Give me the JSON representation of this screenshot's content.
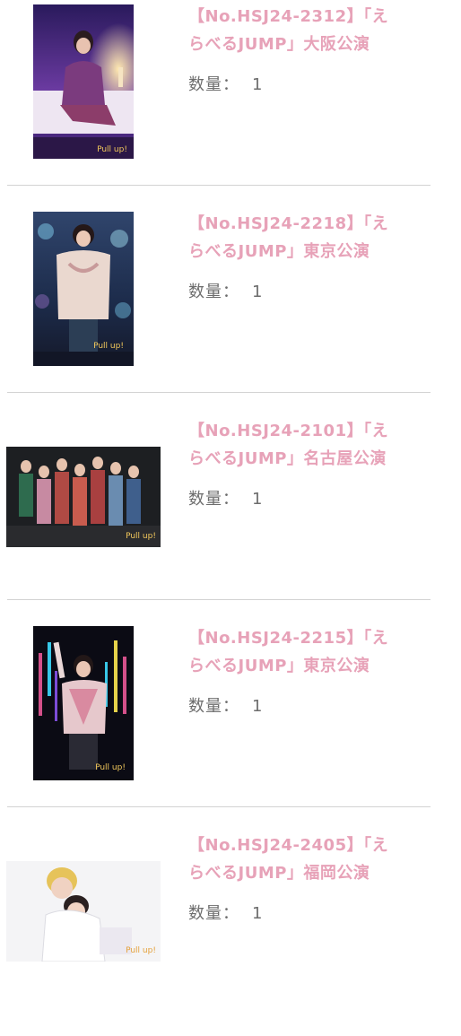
{
  "items": [
    {
      "title_line1": "【No.HSJ24-2312】「え",
      "title_line2": "らべるJUMP」大阪公演",
      "quantity_label": "数量：",
      "quantity_value": "1",
      "photo": {
        "orientation": "portrait",
        "scene": "solo-seated-candle",
        "colors": [
          "#3a1f6e",
          "#b05ab8",
          "#f2e7f5"
        ]
      }
    },
    {
      "title_line1": "【No.HSJ24-2218】「え",
      "title_line2": "らべるJUMP」東京公演",
      "quantity_label": "数量：",
      "quantity_value": "1",
      "photo": {
        "orientation": "portrait",
        "scene": "solo-heart-hands",
        "colors": [
          "#1c2b4a",
          "#e9d2cf",
          "#6aa7c8"
        ]
      }
    },
    {
      "title_line1": "【No.HSJ24-2101】「え",
      "title_line2": "らべるJUMP」名古屋公演",
      "quantity_label": "数量：",
      "quantity_value": "1",
      "photo": {
        "orientation": "landscape",
        "scene": "group-stage",
        "colors": [
          "#1d1f22",
          "#b04a44",
          "#2e6b4e"
        ]
      }
    },
    {
      "title_line1": "【No.HSJ24-2215】「え",
      "title_line2": "らべるJUMP」東京公演",
      "quantity_label": "数量：",
      "quantity_value": "1",
      "photo": {
        "orientation": "portrait",
        "scene": "solo-neon-lights",
        "colors": [
          "#0b0b14",
          "#d4508a",
          "#38c8e8"
        ]
      }
    },
    {
      "title_line1": "【No.HSJ24-2405】「え",
      "title_line2": "らべるJUMP」福岡公演",
      "quantity_label": "数量：",
      "quantity_value": "1",
      "photo": {
        "orientation": "landscape",
        "scene": "duo-white-studio",
        "colors": [
          "#f4f4f6",
          "#e6c35a",
          "#f2d4d0"
        ]
      }
    }
  ],
  "colors": {
    "title": "#e7a2b8",
    "quantity": "#6d6d6d",
    "divider": "#d3d3d3"
  }
}
